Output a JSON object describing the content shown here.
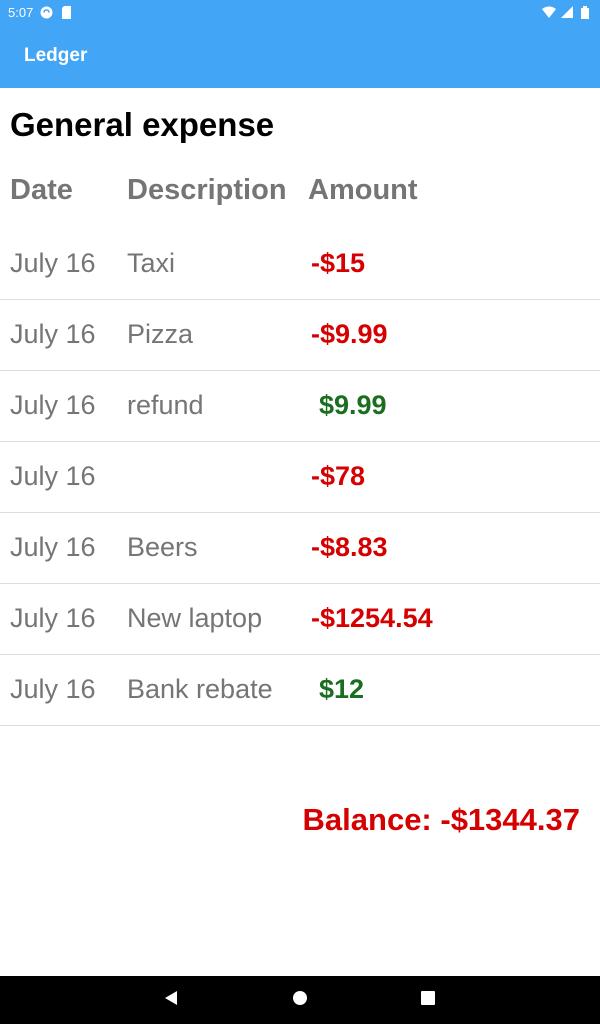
{
  "status_bar": {
    "time": "5:07"
  },
  "app_bar": {
    "title": "Ledger"
  },
  "page": {
    "title": "General expense"
  },
  "table": {
    "headers": {
      "date": "Date",
      "description": "Description",
      "amount": "Amount"
    },
    "rows": [
      {
        "date": "July 16",
        "description": "Taxi",
        "amount": "-$15"
      },
      {
        "date": "July 16",
        "description": "Pizza",
        "amount": "-$9.99"
      },
      {
        "date": "July 16",
        "description": "refund",
        "amount": "$9.99"
      },
      {
        "date": "July 16",
        "description": "",
        "amount": "-$78"
      },
      {
        "date": "July 16",
        "description": "Beers",
        "amount": "-$8.83"
      },
      {
        "date": "July 16",
        "description": "New laptop",
        "amount": "-$1254.54"
      },
      {
        "date": "July 16",
        "description": "Bank rebate",
        "amount": "$12"
      }
    ]
  },
  "balance": {
    "text": "Balance: -$1344.37"
  },
  "colors": {
    "primary": "#42a5f5",
    "negative": "#d50000",
    "positive": "#1b6e20",
    "muted_text": "#757575"
  },
  "icons": {
    "status_left": [
      "sync-icon",
      "sd-card-icon"
    ],
    "status_right": [
      "wifi-icon",
      "signal-icon",
      "battery-icon"
    ],
    "nav": [
      "back-icon",
      "home-icon",
      "recents-icon"
    ]
  }
}
